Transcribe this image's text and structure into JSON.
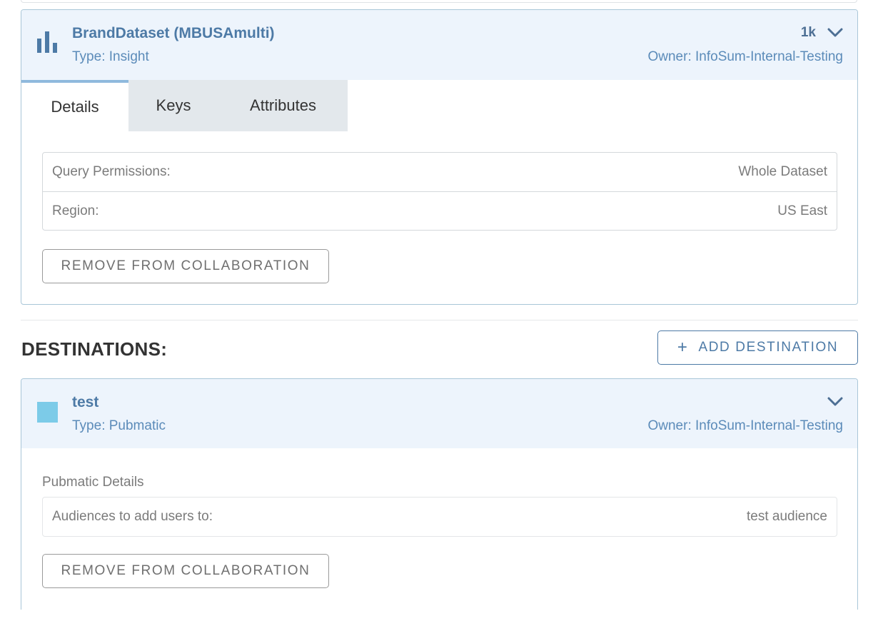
{
  "dataset": {
    "title": "BrandDataset (MBUSAmulti)",
    "type": "Type: Insight",
    "size": "1k",
    "owner": "Owner: InfoSum-Internal-Testing",
    "icon": "bar-chart-icon",
    "tabs": [
      {
        "label": "Details",
        "active": true
      },
      {
        "label": "Keys",
        "active": false
      },
      {
        "label": "Attributes",
        "active": false
      }
    ],
    "details": [
      {
        "label": "Query Permissions:",
        "value": "Whole Dataset"
      },
      {
        "label": "Region:",
        "value": "US East"
      }
    ],
    "remove_label": "REMOVE FROM COLLABORATION"
  },
  "destinations": {
    "heading": "DESTINATIONS:",
    "add_label": "ADD DESTINATION",
    "add_icon": "plus-icon",
    "items": [
      {
        "title": "test",
        "type": "Type: Pubmatic",
        "owner": "Owner: InfoSum-Internal-Testing",
        "icon_color": "#7ccbe8",
        "section_label": "Pubmatic Details",
        "details": [
          {
            "label": "Audiences to add users to:",
            "value": "test audience"
          }
        ],
        "remove_label": "REMOVE FROM COLLABORATION"
      }
    ]
  },
  "colors": {
    "accent": "#4d7aa6",
    "header_bg": "#edf4fc",
    "tab_inactive_bg": "#e3e8ec"
  }
}
